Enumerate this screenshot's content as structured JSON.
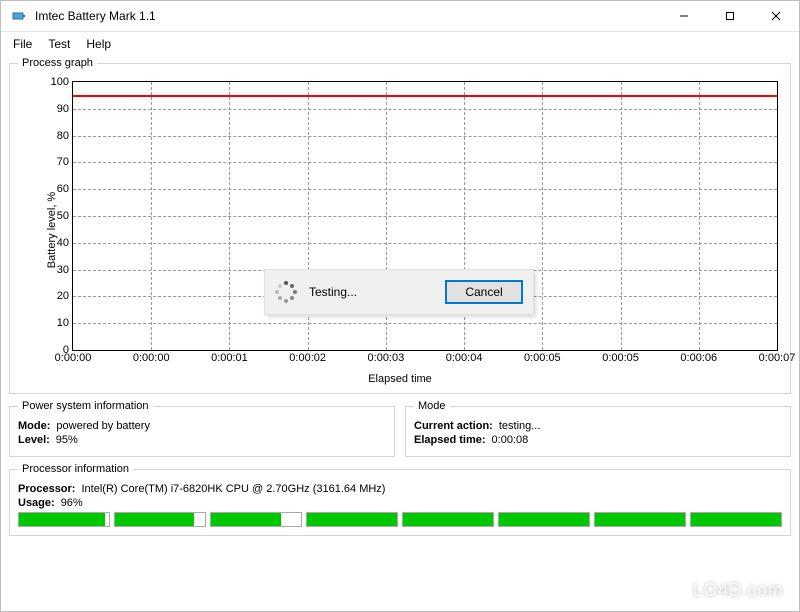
{
  "window": {
    "title": "Imtec Battery Mark 1.1"
  },
  "menu": {
    "file": "File",
    "test": "Test",
    "help": "Help"
  },
  "graph": {
    "legend": "Process graph",
    "ylabel": "Battery level, %",
    "xlabel": "Elapsed time"
  },
  "dialog": {
    "message": "Testing...",
    "cancel": "Cancel"
  },
  "power": {
    "legend": "Power system information",
    "mode_label": "Mode:",
    "mode_value": "powered by battery",
    "level_label": "Level:",
    "level_value": "95%"
  },
  "mode": {
    "legend": "Mode",
    "action_label": "Current action:",
    "action_value": "testing...",
    "elapsed_label": "Elapsed time:",
    "elapsed_value": "0:00:08"
  },
  "proc": {
    "legend": "Processor information",
    "cpu_label": "Processor:",
    "cpu_value": "Intel(R) Core(TM) i7-6820HK CPU @ 2.70GHz  (3161.64 MHz)",
    "usage_label": "Usage:",
    "usage_value": "96%",
    "core_fills": [
      95,
      88,
      78,
      100,
      100,
      100,
      100,
      100
    ]
  },
  "watermark": "LO4D.com",
  "chart_data": {
    "type": "line",
    "title": "Process graph",
    "xlabel": "Elapsed time",
    "ylabel": "Battery level, %",
    "ylim": [
      0,
      100
    ],
    "y_ticks": [
      0,
      10,
      20,
      30,
      40,
      50,
      60,
      70,
      80,
      90,
      100
    ],
    "x_ticks": [
      "0:00:00",
      "0:00:00",
      "0:00:01",
      "0:00:02",
      "0:00:03",
      "0:00:04",
      "0:00:05",
      "0:00:05",
      "0:00:06",
      "0:00:07"
    ],
    "series": [
      {
        "name": "Battery level",
        "color": "#ff0000",
        "constant_value": 95
      }
    ]
  }
}
